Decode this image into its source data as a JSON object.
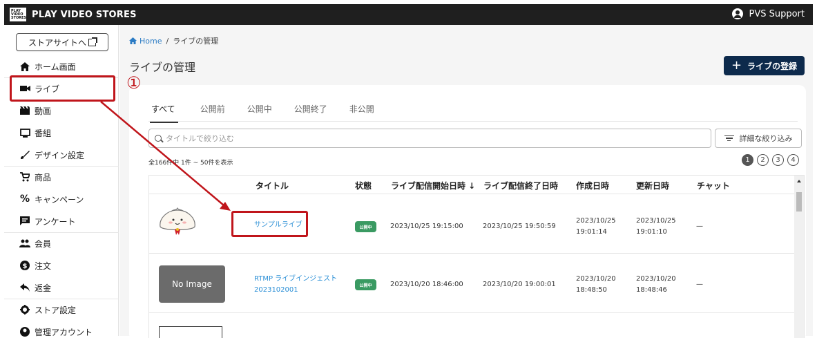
{
  "topbar": {
    "logo_text": "PLAY VIDEO STORES",
    "brand": "PLAY VIDEO STORES",
    "user": "PVS Support"
  },
  "sidebar": {
    "store_button": "ストアサイトへ",
    "items": [
      {
        "label": "ホーム画面",
        "icon": "home-icon"
      },
      {
        "label": "ライブ",
        "icon": "video-camera-icon"
      },
      {
        "label": "動画",
        "icon": "clapperboard-icon"
      },
      {
        "label": "番組",
        "icon": "monitor-icon"
      },
      {
        "label": "デザイン設定",
        "icon": "brush-icon"
      },
      {
        "label": "商品",
        "icon": "cart-icon"
      },
      {
        "label": "キャンペーン",
        "icon": "percent-icon"
      },
      {
        "label": "アンケート",
        "icon": "feedback-icon"
      },
      {
        "label": "会員",
        "icon": "people-icon"
      },
      {
        "label": "注文",
        "icon": "dollar-icon"
      },
      {
        "label": "返金",
        "icon": "reply-icon"
      },
      {
        "label": "ストア設定",
        "icon": "gear-icon"
      },
      {
        "label": "管理アカウント",
        "icon": "account-icon"
      }
    ]
  },
  "breadcrumb": {
    "home": "Home",
    "separator": "/",
    "current": "ライブの管理"
  },
  "page_title": "ライブの管理",
  "add_button": "ライブの登録",
  "tabs": [
    "すべて",
    "公開前",
    "公開中",
    "公開終了",
    "非公開"
  ],
  "search": {
    "placeholder": "タイトルで絞り込む"
  },
  "filter_button": "詳細な絞り込み",
  "count_text": "全166件中 1件 ~ 50件を表示",
  "pagination": [
    "1",
    "2",
    "3",
    "4"
  ],
  "table": {
    "headers": [
      "タイトル",
      "状態",
      "ライブ配信開始日時 ↓",
      "ライブ配信終了日時",
      "作成日時",
      "更新日時",
      "チャット"
    ],
    "rows": [
      {
        "title": "サンプルライブ",
        "status": "公開中",
        "start": "2023/10/25 19:15:00",
        "end": "2023/10/25 19:50:59",
        "created_date": "2023/10/25",
        "created_time": "19:01:14",
        "updated_date": "2023/10/25",
        "updated_time": "19:01:10",
        "chat": "—"
      },
      {
        "title_line1": "RTMP ライブインジェスト",
        "title_line2": "2023102001",
        "status": "公開中",
        "thumb": "No Image",
        "start": "2023/10/20 18:46:00",
        "end": "2023/10/20 19:00:01",
        "created_date": "2023/10/20",
        "created_time": "18:48:50",
        "updated_date": "2023/10/20",
        "updated_time": "18:48:46",
        "chat": "—"
      }
    ]
  },
  "annotation": {
    "step_number": "①"
  },
  "colors": {
    "accent": "#0d2a4c",
    "link": "#2b8fd6",
    "highlight": "#c0151b",
    "badge": "#3a9a62"
  }
}
